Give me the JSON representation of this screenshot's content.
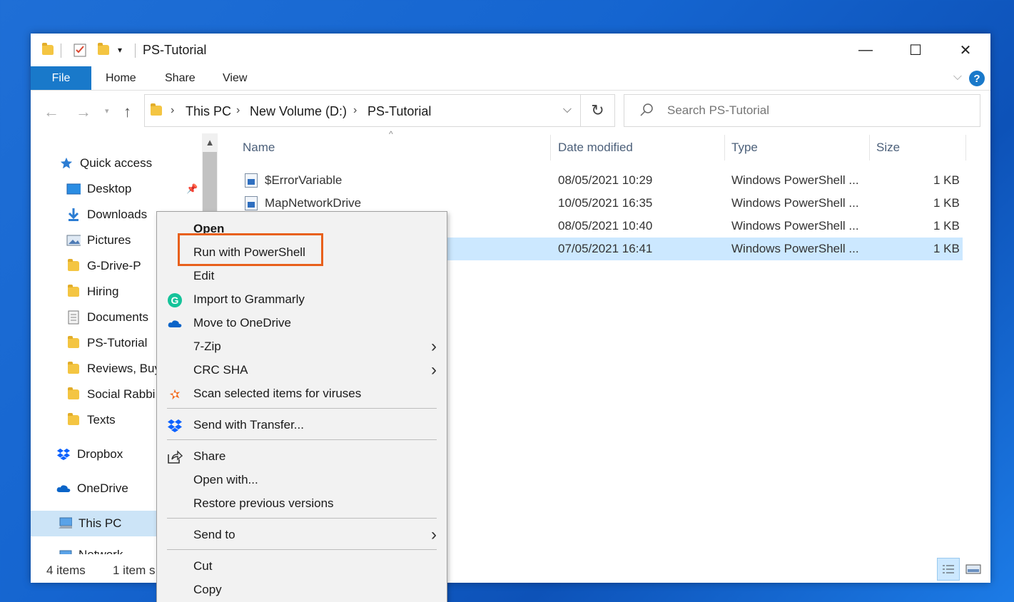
{
  "window": {
    "title": "PS-Tutorial",
    "controls": {
      "minimize": "—",
      "maximize": "☐",
      "close": "✕"
    }
  },
  "ribbon": {
    "tabs": [
      "File",
      "Home",
      "Share",
      "View"
    ],
    "help": "?"
  },
  "address": {
    "crumbs": [
      "This PC",
      "New Volume (D:)",
      "PS-Tutorial"
    ]
  },
  "search": {
    "placeholder": "Search PS-Tutorial"
  },
  "nav_pane": {
    "items": [
      {
        "label": "Quick access",
        "icon": "star-icon"
      },
      {
        "label": "Desktop",
        "icon": "desktop-icon",
        "pinned": true
      },
      {
        "label": "Downloads",
        "icon": "download-icon",
        "pinned": true
      },
      {
        "label": "Pictures",
        "icon": "pictures-icon"
      },
      {
        "label": "G-Drive-P",
        "icon": "folder-icon"
      },
      {
        "label": "Hiring",
        "icon": "folder-icon"
      },
      {
        "label": "Documents",
        "icon": "documents-icon"
      },
      {
        "label": "PS-Tutorial",
        "icon": "folder-icon"
      },
      {
        "label": "Reviews, Buy",
        "icon": "folder-icon"
      },
      {
        "label": "Social Rabbi",
        "icon": "folder-icon"
      },
      {
        "label": "Texts",
        "icon": "folder-icon"
      },
      {
        "label": "Dropbox",
        "icon": "dropbox-icon"
      },
      {
        "label": "OneDrive",
        "icon": "onedrive-icon"
      },
      {
        "label": "This PC",
        "icon": "computer-icon"
      },
      {
        "label": "Network",
        "icon": "network-icon"
      }
    ]
  },
  "file_list": {
    "columns": [
      "Name",
      "Date modified",
      "Type",
      "Size"
    ],
    "rows": [
      {
        "name": "$ErrorVariable",
        "date": "08/05/2021 10:29",
        "type": "Windows PowerShell ...",
        "size": "1 KB"
      },
      {
        "name": "MapNetworkDrive",
        "date": "10/05/2021 16:35",
        "type": "Windows PowerShell ...",
        "size": "1 KB"
      },
      {
        "name": "",
        "date": "08/05/2021 10:40",
        "type": "Windows PowerShell ...",
        "size": "1 KB"
      },
      {
        "name": "",
        "date": "07/05/2021 16:41",
        "type": "Windows PowerShell ...",
        "size": "1 KB",
        "selected": true
      }
    ]
  },
  "status": {
    "count": "4 items",
    "selection": "1 item s"
  },
  "context_menu": {
    "items": [
      {
        "label": "Open",
        "bold": true
      },
      {
        "label": "Run with PowerShell",
        "highlighted": true
      },
      {
        "label": "Edit"
      },
      {
        "label": "Import to Grammarly",
        "icon": "grammarly-icon"
      },
      {
        "label": "Move to OneDrive",
        "icon": "onedrive-icon"
      },
      {
        "label": "7-Zip",
        "submenu": true
      },
      {
        "label": "CRC SHA",
        "submenu": true
      },
      {
        "label": "Scan selected items for viruses",
        "icon": "avast-icon"
      },
      {
        "label": "Send with Transfer...",
        "icon": "dropbox-icon"
      },
      {
        "label": "Share",
        "icon": "share-icon"
      },
      {
        "label": "Open with..."
      },
      {
        "label": "Restore previous versions"
      },
      {
        "label": "Send to",
        "submenu": true
      },
      {
        "label": "Cut"
      },
      {
        "label": "Copy"
      }
    ]
  },
  "colors": {
    "accent": "#1979ca",
    "selection": "#cce8ff",
    "highlight_border": "#e8601c"
  }
}
